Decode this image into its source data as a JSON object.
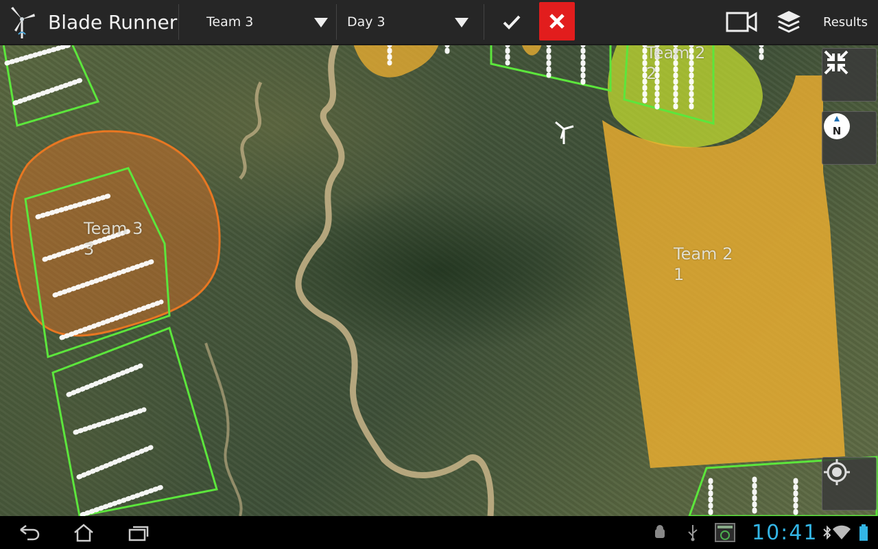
{
  "app": {
    "title": "Blade Runner"
  },
  "toolbar": {
    "team_selected": "Team 3",
    "day_selected": "Day 3",
    "results_label": "Results"
  },
  "map": {
    "zones": [
      {
        "team": "Team 3",
        "number": "3"
      },
      {
        "team": "Team 2",
        "number": "1"
      },
      {
        "team": "Team 2",
        "number": "2"
      }
    ]
  },
  "statusbar": {
    "clock": "10:41"
  },
  "colors": {
    "actionbar": "#262626",
    "cancel_red": "#e21d1d",
    "zone_orange": "#e87722",
    "zone_yellow": "#f0b030",
    "zone_lime": "#c8e030",
    "turbine_green": "#5ce63c",
    "clock_blue": "#33b5e5"
  }
}
